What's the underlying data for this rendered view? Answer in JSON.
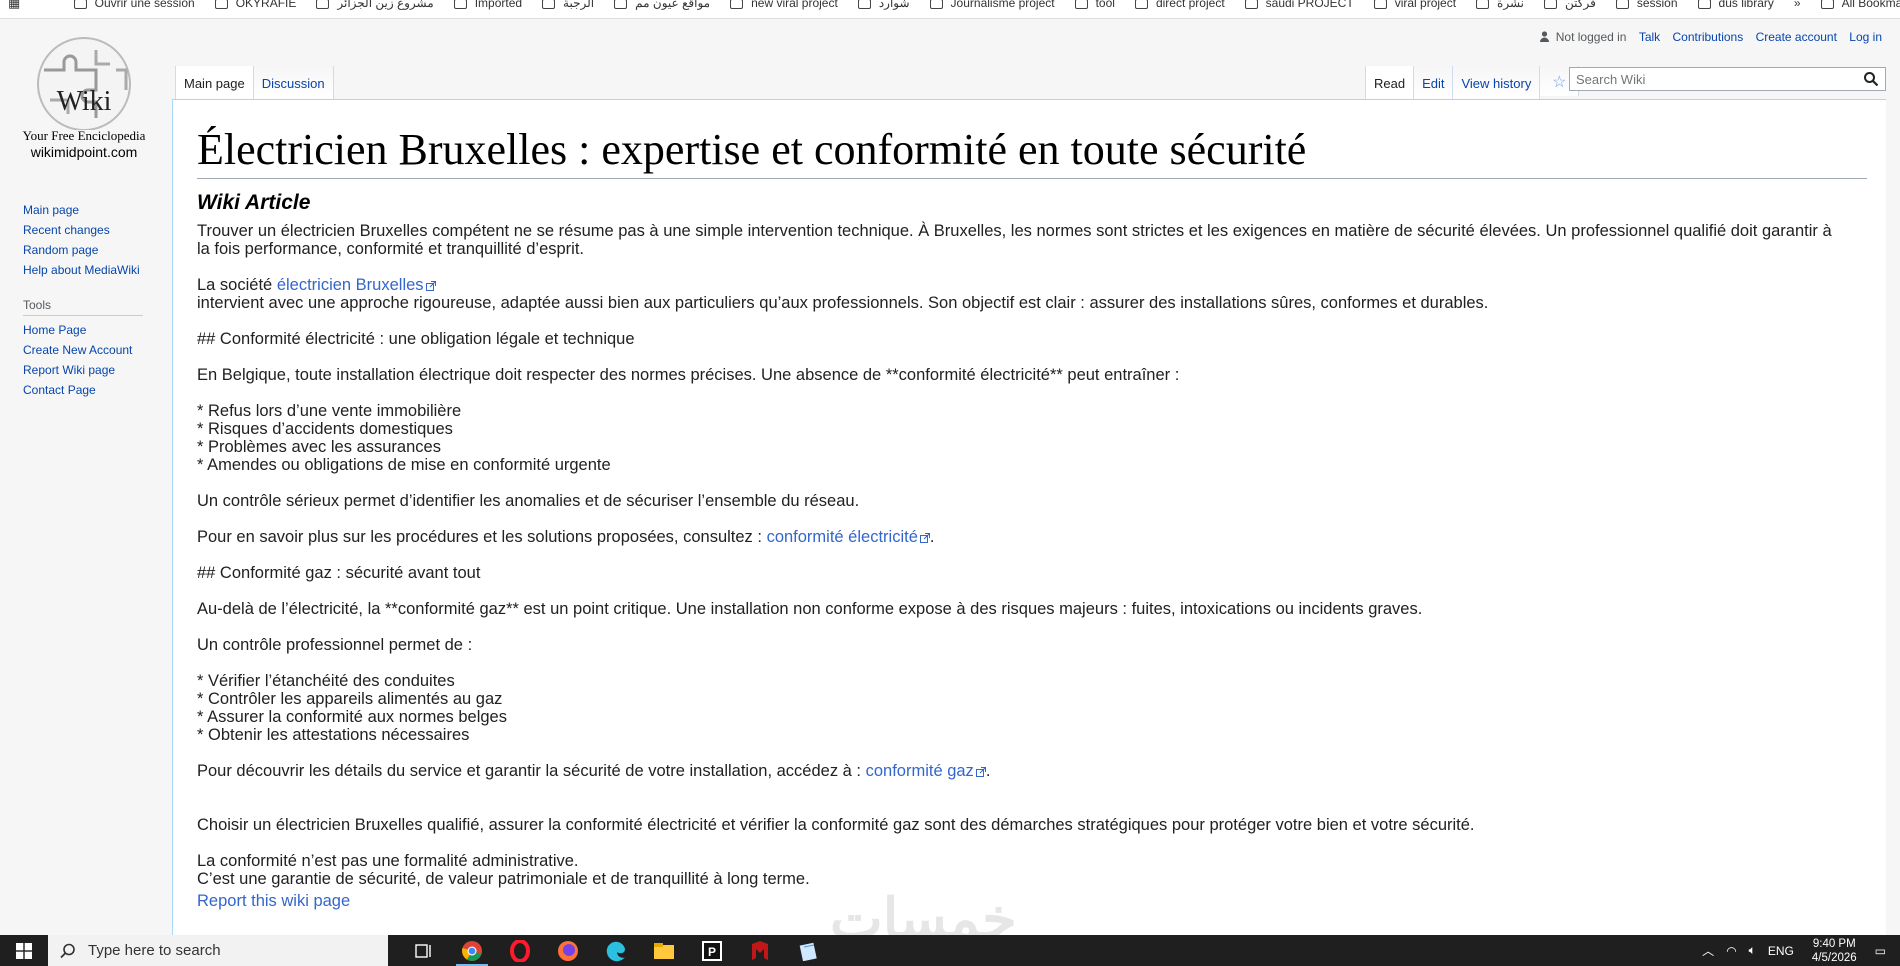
{
  "bookmarks": [
    "Ouvrir une session",
    "OKYRAFIE",
    "مشروع زين الجزائر",
    "Imported",
    "الرجبة",
    "مواقع عيون مم",
    "new viral project",
    "شوارد",
    "Journalisme project",
    "tool",
    "direct project",
    "saudi PROJECT",
    "viral project",
    "نشرة",
    "فركتن",
    "session",
    "dus library"
  ],
  "bookmarks_all": "All Bookmarks",
  "logo": {
    "word": "Wiki",
    "tagline": "Your Free Enciclopedia",
    "site": "wikimidpoint.com"
  },
  "nav": {
    "items": [
      "Main page",
      "Recent changes",
      "Random page",
      "Help about MediaWiki"
    ]
  },
  "tools": {
    "heading": "Tools",
    "items": [
      "Home Page",
      "Create New Account",
      "Report Wiki page",
      "Contact Page"
    ]
  },
  "personal": {
    "status": "Not logged in",
    "links": [
      "Talk",
      "Contributions",
      "Create account",
      "Log in"
    ]
  },
  "tabs": {
    "left": [
      "Main page",
      "Discussion"
    ],
    "right": [
      "Read",
      "Edit",
      "View history"
    ]
  },
  "search": {
    "placeholder": "Search Wiki"
  },
  "article": {
    "title": "Électricien Bruxelles : expertise et conformité en toute sécurité",
    "subtitle": "Wiki Article",
    "p1": "Trouver un électricien Bruxelles compétent ne se résume pas à une simple intervention technique. À Bruxelles, les normes sont strictes et les exigences en matière de sécurité élevées. Un professionnel qualifié doit garantir à la fois performance, conformité et tranquillité d’esprit.",
    "p2_pre": "La société ",
    "p2_link": "électricien Bruxelles",
    "p2_post": "intervient avec une approche rigoureuse, adaptée aussi bien aux particuliers qu’aux professionnels. Son objectif est clair : assurer des installations sûres, conformes et durables.",
    "h_elec": "## Conformité électricité : une obligation légale et technique",
    "p3": "En Belgique, toute installation électrique doit respecter des normes précises. Une absence de **conformité électricité** peut entraîner :",
    "list1": [
      "* Refus lors d’une vente immobilière",
      "* Risques d’accidents domestiques",
      "* Problèmes avec les assurances",
      "* Amendes ou obligations de mise en conformité urgente"
    ],
    "p4": "Un contrôle sérieux permet d’identifier les anomalies et de sécuriser l’ensemble du réseau.",
    "p5_pre": "Pour en savoir plus sur les procédures et les solutions proposées, consultez : ",
    "p5_link": "conformité électricité",
    "p5_post": ".",
    "h_gaz": "## Conformité gaz : sécurité avant tout",
    "p6": "Au-delà de l’électricité, la **conformité gaz** est un point critique. Une installation non conforme expose à des risques majeurs : fuites, intoxications ou incidents graves.",
    "p7": "Un contrôle professionnel permet de :",
    "list2": [
      "* Vérifier l’étanchéité des conduites",
      "* Contrôler les appareils alimentés au gaz",
      "* Assurer la conformité aux normes belges",
      "* Obtenir les attestations nécessaires"
    ],
    "p8_pre": "Pour découvrir les détails du service et garantir la sécurité de votre installation, accédez à : ",
    "p8_link": "conformité gaz",
    "p8_post": ".",
    "p9": "Choisir un électricien Bruxelles qualifié, assurer la conformité électricité et vérifier la conformité gaz sont des démarches stratégiques pour protéger votre bien et votre sécurité.",
    "p10a": "La conformité n’est pas une formalité administrative.",
    "p10b": "C’est une garantie de sécurité, de valeur patrimoniale et de tranquillité à long terme.",
    "report_link": "Report this wiki page"
  },
  "watermark": "خمسات",
  "taskbar": {
    "search_placeholder": "Type here to search",
    "language": "ENG",
    "time": "9:40 PM",
    "date": "4/5/2026"
  },
  "colors": {
    "link": "#3366cc",
    "sidebar_link": "#0645ad",
    "taskbar": "#1f1f1f"
  }
}
